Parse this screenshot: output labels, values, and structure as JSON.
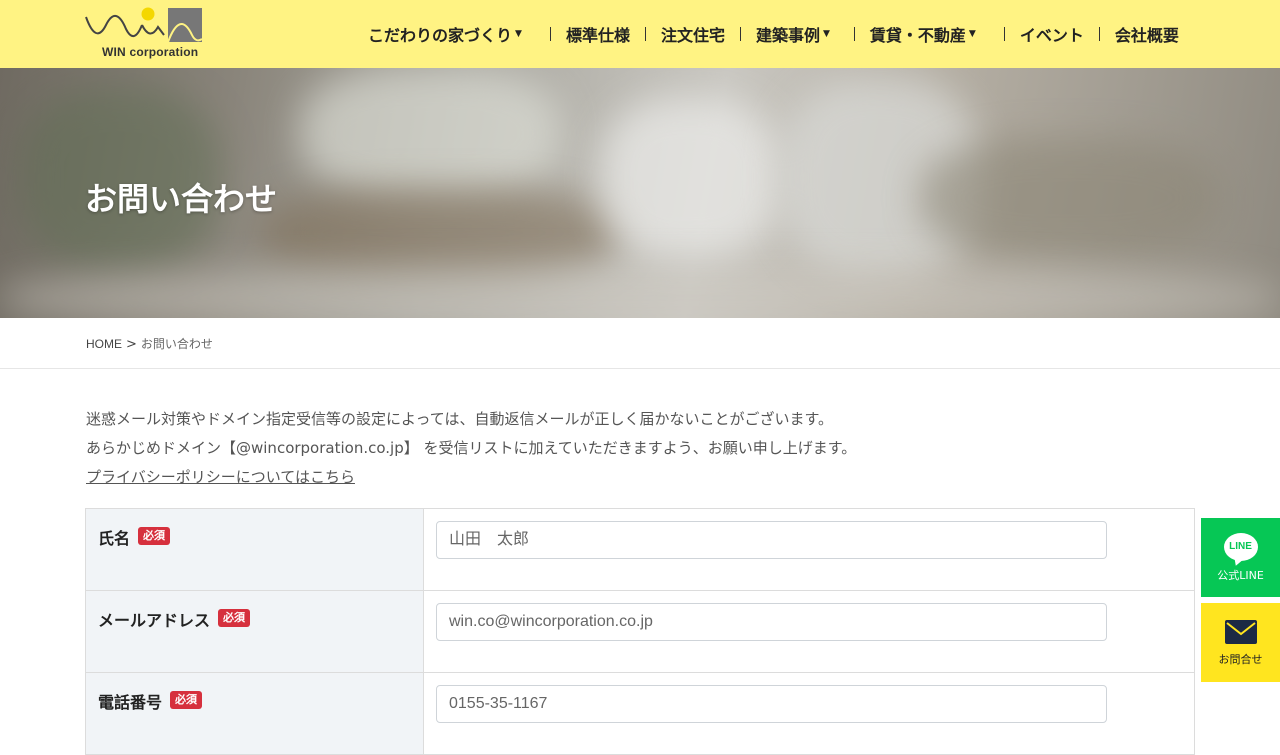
{
  "header": {
    "logo_text": "WIN corporation",
    "nav": [
      {
        "label": "こだわりの家づくり",
        "has_dropdown": true
      },
      {
        "label": "標準仕様",
        "has_dropdown": false
      },
      {
        "label": "注文住宅",
        "has_dropdown": false
      },
      {
        "label": "建築事例",
        "has_dropdown": true
      },
      {
        "label": "賃貸・不動産",
        "has_dropdown": true
      },
      {
        "label": "イベント",
        "has_dropdown": false
      },
      {
        "label": "会社概要",
        "has_dropdown": false
      }
    ]
  },
  "hero": {
    "title": "お問い合わせ"
  },
  "breadcrumb": {
    "home": "HOME",
    "separator": ">",
    "current": "お問い合わせ"
  },
  "notice": {
    "line1": "迷惑メール対策やドメイン指定受信等の設定によっては、自動返信メールが正しく届かないことがございます。",
    "line2": "あらかじめドメイン【@wincorporation.co.jp】 を受信リストに加えていただきますよう、お願い申し上げます。",
    "privacy_link": "プライバシーポリシーについてはこちら"
  },
  "form": {
    "required_badge": "必須",
    "fields": [
      {
        "label": "氏名",
        "placeholder": "山田　太郎"
      },
      {
        "label": "メールアドレス",
        "placeholder": "win.co@wincorporation.co.jp"
      },
      {
        "label": "電話番号",
        "placeholder": "0155-35-1167"
      }
    ]
  },
  "side_buttons": {
    "line_icon_text": "LINE",
    "line_label": "公式LINE",
    "mail_label": "お問合せ"
  },
  "colors": {
    "header_bg": "#fff383",
    "required_badge": "#d6303d",
    "line_green": "#06c755",
    "contact_yellow": "#ffe51f"
  }
}
